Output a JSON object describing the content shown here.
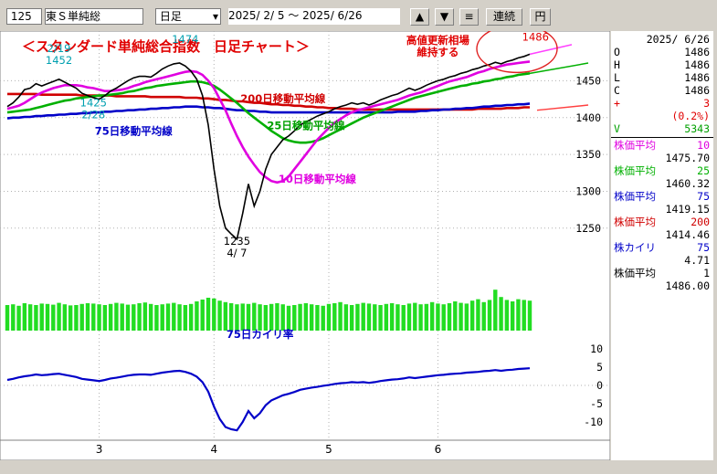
{
  "toolbar": {
    "code": "125",
    "name": "東Ｓ単純総",
    "period": "日足",
    "date_range": "2025/ 2/ 5 ～  2025/ 6/26",
    "up_label": "▲",
    "down_label": "▼",
    "menu_label": "≡",
    "renzoku_label": "連続",
    "yen_label": "円"
  },
  "info": {
    "date": "2025/ 6/26",
    "ohlc": [
      {
        "k": "O",
        "v": "1486"
      },
      {
        "k": "H",
        "v": "1486"
      },
      {
        "k": "L",
        "v": "1486"
      },
      {
        "k": "C",
        "v": "1486"
      }
    ],
    "change_sign": "+",
    "change": "3",
    "change_pct": "(0.2%)",
    "volume_label": "V",
    "volume": "5343",
    "indicators": [
      {
        "label": "株価平均",
        "period": "10",
        "value": "1475.70",
        "color": "#e000e0"
      },
      {
        "label": "株価平均",
        "period": "25",
        "value": "1460.32",
        "color": "#00b000"
      },
      {
        "label": "株価平均",
        "period": "75",
        "value": "1419.15",
        "color": "#0000c8"
      },
      {
        "label": "株価平均",
        "period": "200",
        "value": "1414.46",
        "color": "#d00000"
      },
      {
        "label": "株カイリ",
        "period": "75",
        "value": "4.71",
        "color": "#0000c8"
      },
      {
        "label": "株価平均",
        "period": "1",
        "value": "1486.00",
        "color": "#000000"
      }
    ]
  },
  "chart_data": {
    "type": "line",
    "title": "＜スタンダード単純総合指数　日足チャート＞",
    "title_color": "#e00000",
    "price_ylim": [
      1220,
      1510
    ],
    "price_ticks": [
      1450,
      1400,
      1350,
      1300,
      1250
    ],
    "month_labels": [
      {
        "label": "3",
        "day": 16
      },
      {
        "label": "4",
        "day": 36
      },
      {
        "label": "5",
        "day": 56
      },
      {
        "label": "6",
        "day": 75
      }
    ],
    "annotations": [
      {
        "text": "2/19\n1452",
        "day": 9,
        "price": 1452,
        "color": "#00a0b0"
      },
      {
        "text": "1474",
        "day": 31,
        "price": 1474,
        "color": "#00a0b0"
      },
      {
        "text": "1425\n2/28",
        "day": 15,
        "price": 1425,
        "color": "#00a0b0"
      },
      {
        "text": "1235\n4/ 7",
        "day": 40,
        "price": 1235,
        "color": "#000000"
      },
      {
        "text": "6/26\n1486",
        "day": 92,
        "price": 1486,
        "color": "#e00000"
      },
      {
        "text": "高値更新相場\n維持する",
        "day": 75,
        "price": 1478,
        "color": "#e00000"
      },
      {
        "text": "200日移動平均線",
        "day": 48,
        "price": 1421,
        "color": "#d00000"
      },
      {
        "text": "25日移動平均線",
        "day": 52,
        "price": 1384,
        "color": "#00a000"
      },
      {
        "text": "75日移動平均線",
        "day": 22,
        "price": 1377,
        "color": "#0000c8"
      },
      {
        "text": "10日移動平均線",
        "day": 54,
        "price": 1312,
        "color": "#e000e0"
      },
      {
        "text": "75日カイリ率",
        "day": 44,
        "price": null,
        "color": "#0000c8"
      }
    ],
    "series": [
      {
        "name": "株価",
        "color": "#000000",
        "values": [
          1415,
          1420,
          1428,
          1438,
          1440,
          1446,
          1443,
          1446,
          1449,
          1452,
          1448,
          1444,
          1440,
          1433,
          1430,
          1427,
          1425,
          1430,
          1436,
          1440,
          1445,
          1450,
          1454,
          1456,
          1456,
          1455,
          1460,
          1466,
          1470,
          1473,
          1474,
          1470,
          1463,
          1452,
          1430,
          1390,
          1330,
          1280,
          1250,
          1242,
          1235,
          1270,
          1310,
          1280,
          1300,
          1330,
          1350,
          1360,
          1370,
          1375,
          1382,
          1390,
          1394,
          1398,
          1402,
          1405,
          1408,
          1412,
          1415,
          1417,
          1420,
          1418,
          1420,
          1417,
          1420,
          1424,
          1427,
          1430,
          1432,
          1436,
          1440,
          1437,
          1440,
          1444,
          1447,
          1450,
          1452,
          1455,
          1457,
          1460,
          1462,
          1465,
          1467,
          1470,
          1472,
          1475,
          1473,
          1476,
          1478,
          1481,
          1483,
          1486
        ]
      },
      {
        "name": "10日移動平均線",
        "color": "#e000e0",
        "values": [
          1412,
          1414,
          1416,
          1420,
          1425,
          1430,
          1434,
          1437,
          1440,
          1442,
          1444,
          1444,
          1444,
          1443,
          1441,
          1440,
          1438,
          1436,
          1436,
          1437,
          1438,
          1440,
          1443,
          1445,
          1448,
          1450,
          1452,
          1454,
          1456,
          1458,
          1460,
          1462,
          1463,
          1462,
          1458,
          1450,
          1440,
          1425,
          1410,
          1392,
          1375,
          1360,
          1347,
          1336,
          1326,
          1319,
          1314,
          1312,
          1314,
          1320,
          1330,
          1340,
          1350,
          1360,
          1370,
          1378,
          1386,
          1393,
          1398,
          1403,
          1407,
          1410,
          1412,
          1414,
          1416,
          1418,
          1420,
          1422,
          1424,
          1427,
          1430,
          1432,
          1434,
          1437,
          1440,
          1443,
          1446,
          1449,
          1451,
          1453,
          1455,
          1458,
          1461,
          1463,
          1466,
          1468,
          1470,
          1472,
          1473,
          1474,
          1475,
          1476
        ]
      },
      {
        "name": "25日移動平均線",
        "color": "#00b000",
        "values": [
          1407,
          1408,
          1409,
          1410,
          1411,
          1413,
          1415,
          1417,
          1419,
          1421,
          1423,
          1424,
          1426,
          1427,
          1428,
          1429,
          1430,
          1430,
          1431,
          1432,
          1433,
          1435,
          1436,
          1438,
          1440,
          1441,
          1443,
          1444,
          1445,
          1446,
          1447,
          1448,
          1449,
          1449,
          1448,
          1446,
          1443,
          1438,
          1432,
          1426,
          1420,
          1413,
          1406,
          1400,
          1394,
          1388,
          1382,
          1377,
          1372,
          1369,
          1367,
          1366,
          1366,
          1367,
          1369,
          1372,
          1376,
          1380,
          1384,
          1388,
          1392,
          1396,
          1400,
          1403,
          1406,
          1409,
          1412,
          1415,
          1418,
          1421,
          1424,
          1427,
          1429,
          1431,
          1433,
          1435,
          1437,
          1439,
          1441,
          1443,
          1444,
          1446,
          1447,
          1449,
          1450,
          1452,
          1453,
          1455,
          1456,
          1458,
          1459,
          1460
        ]
      },
      {
        "name": "75日移動平均線",
        "color": "#0000c8",
        "values": [
          1399,
          1400,
          1400,
          1401,
          1401,
          1402,
          1402,
          1403,
          1403,
          1404,
          1404,
          1405,
          1405,
          1406,
          1406,
          1407,
          1407,
          1408,
          1408,
          1409,
          1409,
          1410,
          1410,
          1411,
          1411,
          1412,
          1412,
          1413,
          1413,
          1414,
          1414,
          1415,
          1415,
          1415,
          1414,
          1414,
          1413,
          1413,
          1412,
          1411,
          1410,
          1410,
          1409,
          1409,
          1408,
          1408,
          1407,
          1407,
          1407,
          1407,
          1407,
          1407,
          1407,
          1407,
          1407,
          1407,
          1407,
          1407,
          1407,
          1407,
          1407,
          1407,
          1407,
          1407,
          1407,
          1407,
          1407,
          1407,
          1408,
          1408,
          1408,
          1408,
          1409,
          1409,
          1410,
          1410,
          1411,
          1411,
          1412,
          1412,
          1413,
          1413,
          1414,
          1415,
          1415,
          1416,
          1416,
          1417,
          1417,
          1418,
          1418,
          1419
        ]
      },
      {
        "name": "200日移動平均線",
        "color": "#d00000",
        "values": [
          1432,
          1432,
          1432,
          1432,
          1432,
          1432,
          1431,
          1431,
          1431,
          1431,
          1431,
          1431,
          1431,
          1430,
          1430,
          1430,
          1430,
          1430,
          1430,
          1429,
          1429,
          1429,
          1429,
          1429,
          1429,
          1428,
          1428,
          1428,
          1428,
          1428,
          1428,
          1427,
          1427,
          1427,
          1426,
          1426,
          1425,
          1424,
          1424,
          1423,
          1422,
          1422,
          1421,
          1420,
          1420,
          1419,
          1418,
          1418,
          1417,
          1417,
          1416,
          1416,
          1415,
          1415,
          1414,
          1414,
          1413,
          1413,
          1412,
          1412,
          1412,
          1411,
          1411,
          1411,
          1411,
          1411,
          1411,
          1411,
          1411,
          1411,
          1411,
          1411,
          1411,
          1411,
          1411,
          1411,
          1411,
          1411,
          1411,
          1411,
          1411,
          1411,
          1412,
          1412,
          1412,
          1412,
          1412,
          1413,
          1413,
          1413,
          1414,
          1414
        ]
      },
      {
        "name": "75日カイリ率",
        "color": "#0000c8",
        "values": [
          1.5,
          1.8,
          2.2,
          2.5,
          2.7,
          3.0,
          2.8,
          2.9,
          3.1,
          3.2,
          2.9,
          2.6,
          2.3,
          1.8,
          1.6,
          1.4,
          1.2,
          1.5,
          1.9,
          2.1,
          2.4,
          2.7,
          2.9,
          3.0,
          3.0,
          2.9,
          3.2,
          3.5,
          3.7,
          3.9,
          4.0,
          3.7,
          3.2,
          2.4,
          0.9,
          -1.7,
          -5.8,
          -9.2,
          -11.4,
          -12.0,
          -12.3,
          -10.0,
          -7.0,
          -9.0,
          -7.6,
          -5.4,
          -4.1,
          -3.4,
          -2.7,
          -2.3,
          -1.8,
          -1.2,
          -0.9,
          -0.6,
          -0.4,
          -0.1,
          0.1,
          0.4,
          0.6,
          0.7,
          0.9,
          0.8,
          0.9,
          0.7,
          0.9,
          1.2,
          1.4,
          1.6,
          1.7,
          1.9,
          2.2,
          2.0,
          2.2,
          2.4,
          2.6,
          2.8,
          2.9,
          3.1,
          3.2,
          3.3,
          3.5,
          3.6,
          3.7,
          3.9,
          4.0,
          4.2,
          4.0,
          4.2,
          4.3,
          4.5,
          4.6,
          4.7
        ]
      }
    ],
    "volume": [
      70,
      72,
      68,
      75,
      72,
      70,
      74,
      73,
      71,
      76,
      72,
      69,
      70,
      73,
      75,
      74,
      72,
      70,
      73,
      76,
      74,
      71,
      72,
      75,
      77,
      73,
      70,
      72,
      74,
      76,
      72,
      70,
      73,
      80,
      85,
      90,
      88,
      82,
      78,
      75,
      72,
      74,
      73,
      76,
      72,
      70,
      73,
      75,
      72,
      68,
      70,
      73,
      75,
      72,
      70,
      68,
      73,
      75,
      78,
      72,
      70,
      73,
      76,
      74,
      72,
      70,
      73,
      75,
      72,
      70,
      74,
      76,
      72,
      73,
      78,
      74,
      72,
      75,
      80,
      76,
      74,
      82,
      86,
      78,
      84,
      112,
      92,
      84,
      80,
      86,
      84,
      82
    ],
    "kairi_ticks": [
      10,
      5,
      0,
      -5,
      -10
    ],
    "kairi_ylim": [
      -13,
      12
    ]
  }
}
